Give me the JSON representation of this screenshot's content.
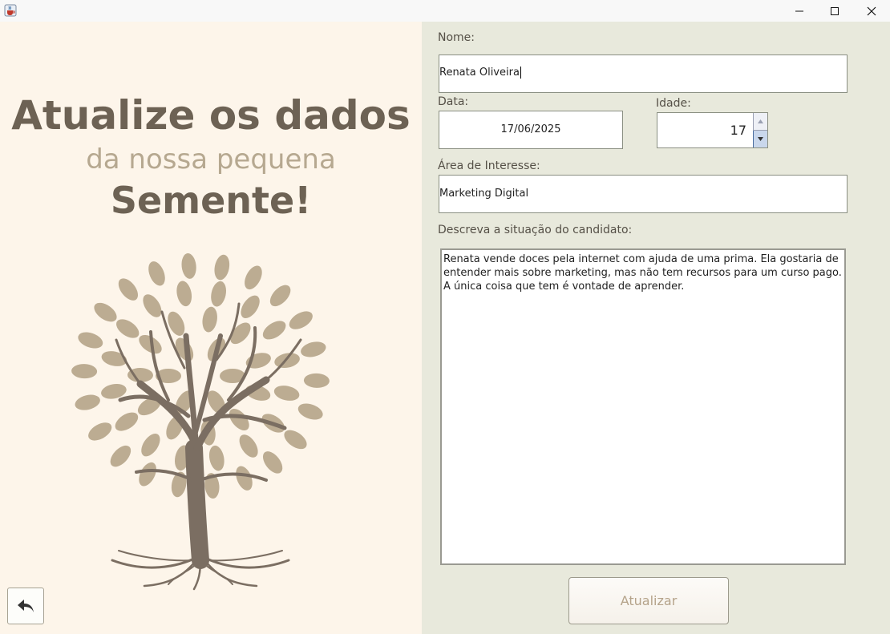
{
  "window": {
    "icon": "java-cup-icon"
  },
  "left_panel": {
    "headline_line1": "Atualize os dados",
    "headline_line2": "da nossa pequena",
    "headline_line3": "Semente!",
    "illustration": "tree-of-knowledge-illustration",
    "back_icon": "back-arrow-icon"
  },
  "form": {
    "name_label": "Nome:",
    "name_value": "Renata Oliveira",
    "date_label": "Data:",
    "date_value": "17/06/2025",
    "age_label": "Idade:",
    "age_value": "17",
    "interest_label": "Área de Interesse:",
    "interest_value": "Marketing Digital",
    "description_label": "Descreva a situação do candidato:",
    "description_value": "Renata vende doces pela internet com ajuda de uma prima. Ela gostaria de entender mais sobre marketing, mas não tem recursos para um curso pago. A única coisa que tem é vontade de aprender.",
    "submit_label": "Atualizar"
  },
  "colors": {
    "left_bg": "#fdf5ea",
    "right_bg": "#e8e9dc",
    "heading": "#6d6254",
    "subheading": "#b6a890",
    "tree_leaf": "#bcac92",
    "tree_trunk": "#7b6e62"
  }
}
